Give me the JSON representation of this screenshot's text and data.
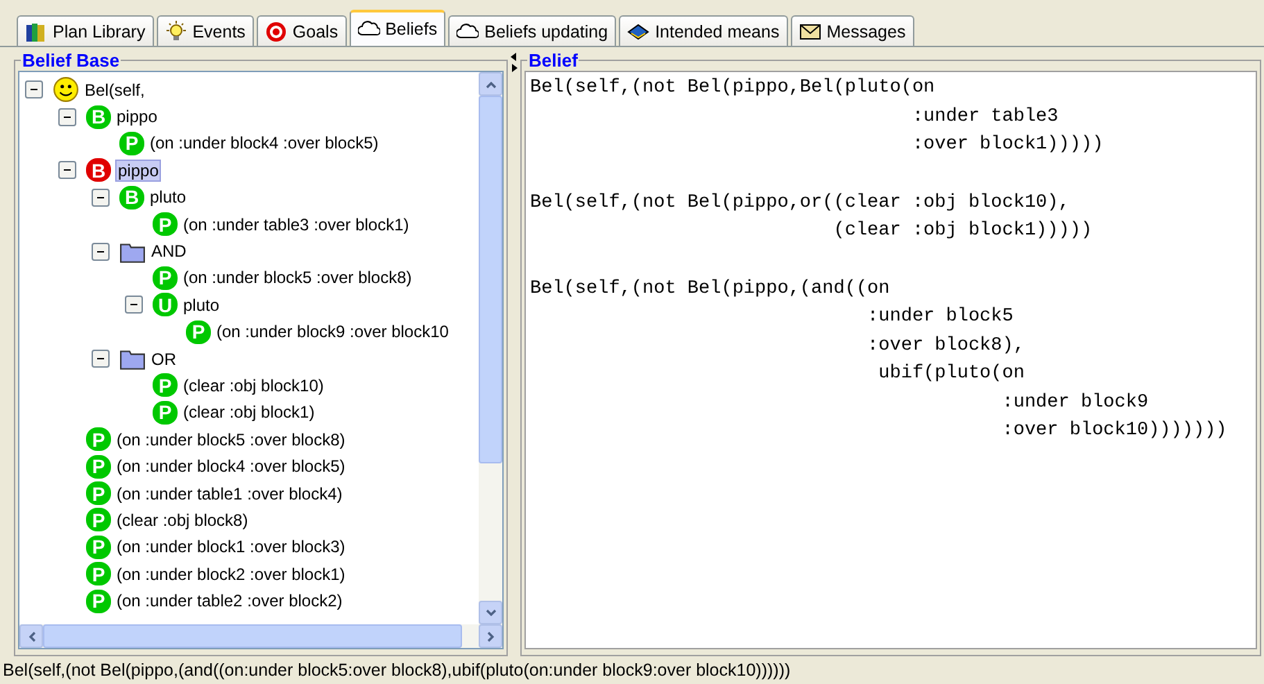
{
  "tabs": [
    {
      "label": "Plan Library",
      "selected": false
    },
    {
      "label": "Events",
      "selected": false
    },
    {
      "label": "Goals",
      "selected": false
    },
    {
      "label": "Beliefs",
      "selected": true
    },
    {
      "label": "Beliefs updating",
      "selected": false
    },
    {
      "label": "Intended means",
      "selected": false
    },
    {
      "label": "Messages",
      "selected": false
    }
  ],
  "belief_base": {
    "title": "Belief Base",
    "tree": [
      {
        "kind": "agent",
        "label": "Bel(self,",
        "expanded": true,
        "selected": false,
        "children": [
          {
            "kind": "belief",
            "badge": "B",
            "color": "#00c800",
            "label": "pippo",
            "expanded": true,
            "selected": false,
            "children": [
              {
                "kind": "belief",
                "badge": "P",
                "color": "#00c800",
                "label": "(on :under block4 :over block5)",
                "selected": false
              }
            ]
          },
          {
            "kind": "belief",
            "badge": "B",
            "color": "#e00000",
            "label": "pippo",
            "expanded": true,
            "selected": true,
            "children": [
              {
                "kind": "belief",
                "badge": "B",
                "color": "#00c800",
                "label": "pluto",
                "expanded": true,
                "selected": false,
                "children": [
                  {
                    "kind": "belief",
                    "badge": "P",
                    "color": "#00c800",
                    "label": "(on :under table3 :over block1)",
                    "selected": false
                  }
                ]
              },
              {
                "kind": "folder",
                "label": "AND",
                "expanded": true,
                "selected": false,
                "children": [
                  {
                    "kind": "belief",
                    "badge": "P",
                    "color": "#00c800",
                    "label": "(on :under block5 :over block8)",
                    "selected": false
                  },
                  {
                    "kind": "belief",
                    "badge": "U",
                    "color": "#00c800",
                    "label": "pluto",
                    "expanded": true,
                    "selected": false,
                    "children": [
                      {
                        "kind": "belief",
                        "badge": "P",
                        "color": "#00c800",
                        "label": "(on :under block9 :over block10",
                        "selected": false
                      }
                    ]
                  }
                ]
              },
              {
                "kind": "folder",
                "label": "OR",
                "expanded": true,
                "selected": false,
                "children": [
                  {
                    "kind": "belief",
                    "badge": "P",
                    "color": "#00c800",
                    "label": "(clear :obj block10)",
                    "selected": false
                  },
                  {
                    "kind": "belief",
                    "badge": "P",
                    "color": "#00c800",
                    "label": "(clear :obj block1)",
                    "selected": false
                  }
                ]
              }
            ]
          },
          {
            "kind": "belief",
            "badge": "P",
            "color": "#00c800",
            "label": "(on :under block5 :over block8)",
            "selected": false
          },
          {
            "kind": "belief",
            "badge": "P",
            "color": "#00c800",
            "label": "(on :under block4 :over block5)",
            "selected": false
          },
          {
            "kind": "belief",
            "badge": "P",
            "color": "#00c800",
            "label": "(on :under table1 :over block4)",
            "selected": false
          },
          {
            "kind": "belief",
            "badge": "P",
            "color": "#00c800",
            "label": "(clear :obj block8)",
            "selected": false
          },
          {
            "kind": "belief",
            "badge": "P",
            "color": "#00c800",
            "label": "(on :under block1 :over block3)",
            "selected": false
          },
          {
            "kind": "belief",
            "badge": "P",
            "color": "#00c800",
            "label": "(on :under block2 :over block1)",
            "selected": false
          },
          {
            "kind": "belief",
            "badge": "P",
            "color": "#00c800",
            "label": "(on :under table2 :over block2)",
            "selected": false
          }
        ]
      }
    ]
  },
  "belief": {
    "title": "Belief",
    "blocks": [
      [
        "Bel(self,(not Bel(pippo,Bel(pluto(on",
        "                                  :under table3",
        "                                  :over block1)))))"
      ],
      [
        "Bel(self,(not Bel(pippo,or((clear :obj block10),",
        "                           (clear :obj block1)))))"
      ],
      [
        "Bel(self,(not Bel(pippo,(and((on",
        "                              :under block5",
        "                              :over block8),",
        "                               ubif(pluto(on",
        "                                          :under block9",
        "                                          :over block10)))))))"
      ]
    ]
  },
  "status_bar": "Bel(self,(not Bel(pippo,(and((on:under block5:over block8),ubif(pluto(on:under block9:over block10))))))"
}
